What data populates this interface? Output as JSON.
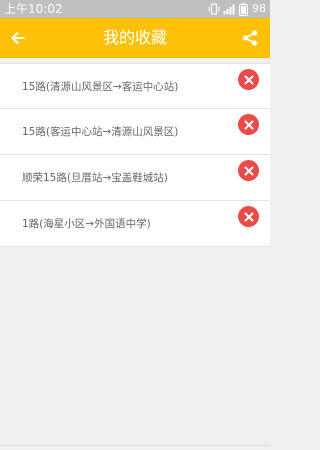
{
  "status_bar": {
    "time": "上午10:02",
    "battery": "98",
    "icons": [
      "vibrate-icon",
      "signal-icon",
      "battery-icon"
    ]
  },
  "header": {
    "title": "我的收藏",
    "back_icon": "back-arrow-icon",
    "share_icon": "share-icon",
    "background_color": "#ffc107"
  },
  "favorites": [
    {
      "label": "15路(清源山风景区→客运中心站)"
    },
    {
      "label": "15路(客运中心站→清源山风景区)"
    },
    {
      "label": "顺荣15路(旦厝站→宝盖鞋城站)"
    },
    {
      "label": "1路(海星小区→外国语中学)"
    }
  ],
  "delete_icon": "delete-x-icon",
  "delete_color": "#e94b4b"
}
